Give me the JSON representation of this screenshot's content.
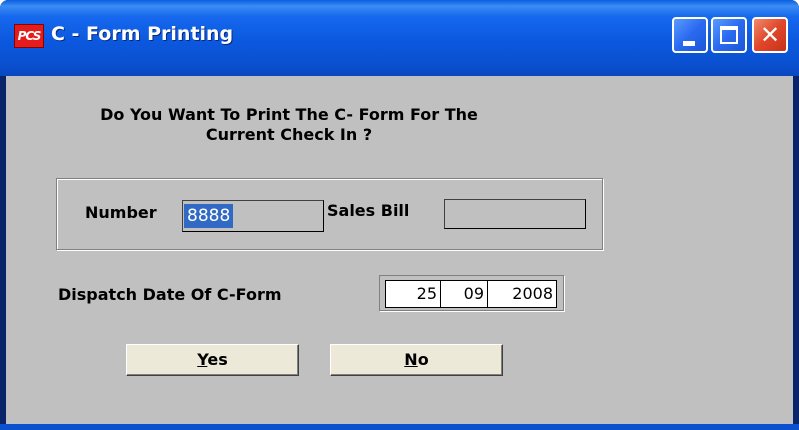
{
  "window": {
    "icon_text": "PCS",
    "title": "C - Form Printing"
  },
  "dialog": {
    "question": "Do You Want To Print The C- Form For The\nCurrent Check In ?",
    "number_label": "Number",
    "number_value": "8888",
    "sales_bill_label": "Sales Bill",
    "sales_bill_value": "",
    "dispatch_label": "Dispatch Date Of C-Form",
    "date": {
      "day": "25",
      "month": "09",
      "year": "2008"
    },
    "yes_accel": "Y",
    "yes_rest": "es",
    "no_accel": "N",
    "no_rest": "o"
  },
  "colors": {
    "title_bar": "#0a5fe0",
    "dialog_bg": "#c0c0c0",
    "selection": "#316ac5",
    "button_face": "#ece9d8",
    "close_button": "#e0462a"
  }
}
